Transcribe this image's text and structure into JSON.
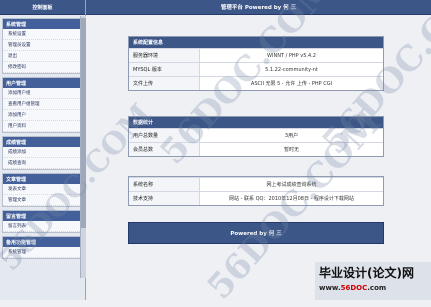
{
  "sidebar": {
    "title": "控制面板",
    "groups": [
      {
        "title": "系统管理",
        "items": [
          "系统设置",
          "管理员设置",
          "退出",
          "修改密码"
        ]
      },
      {
        "title": "用户管理",
        "items": [
          "添加用户组",
          "查看用户组管理",
          "添加用户",
          "用户资料"
        ]
      },
      {
        "title": "成绩管理",
        "items": [
          "成绩添加",
          "成绩查询"
        ]
      },
      {
        "title": "文章管理",
        "items": [
          "发表文章",
          "管理文章"
        ]
      },
      {
        "title": "留言管理",
        "items": [
          "留言列表"
        ]
      },
      {
        "title": "备用功能管理",
        "items": [
          "系统管理"
        ]
      }
    ]
  },
  "topbar": {
    "title": "管理平台 Powered by 何 三"
  },
  "sysinfo": {
    "title": "系统配置信息",
    "rows": [
      {
        "k": "服务器环境",
        "v": "WINNT / PHP v5.4.2"
      },
      {
        "k": "MYSQL 版本",
        "v": "5.1.22-community-nt"
      },
      {
        "k": "文件上传",
        "v": "ASCII 无限 5 - 允许 上传 - PHP CGI"
      }
    ]
  },
  "stats": {
    "title": "数据统计",
    "rows": [
      {
        "k": "用户总数量",
        "v": "3用户"
      },
      {
        "k": "会员总数",
        "v": "暂时无"
      }
    ]
  },
  "about": {
    "rows": [
      {
        "k": "系统名称",
        "v": "网上考试成绩查询系统"
      },
      {
        "k": "技术支持",
        "v": "网站 - 联系 QQ：2010年12月08日 - 程序设计下载网站"
      }
    ]
  },
  "footer": {
    "text": "Powered by 何 三"
  },
  "watermark": {
    "text": "56DOC.COM",
    "badge_line1": "毕业设计(论文)网",
    "badge_prefix": "www.",
    "badge_domain": "56DOC",
    "badge_suffix": ".com"
  },
  "colors": {
    "header": "#3c5688",
    "sidebar": "#e4e8ef",
    "background": "#eef0f4"
  }
}
